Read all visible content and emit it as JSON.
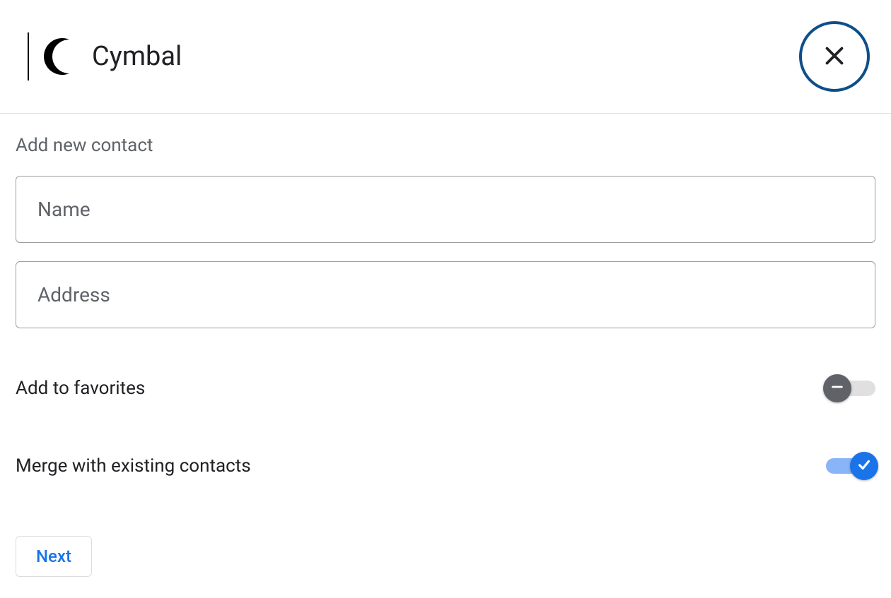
{
  "header": {
    "brand_name": "Cymbal"
  },
  "form": {
    "section_title": "Add new contact",
    "name_placeholder": "Name",
    "name_value": "",
    "address_placeholder": "Address",
    "address_value": "",
    "favorites_label": "Add to favorites",
    "favorites_on": false,
    "merge_label": "Merge with existing contacts",
    "merge_on": true,
    "next_label": "Next"
  },
  "colors": {
    "brand_close_border": "#0d4f8b",
    "primary_blue": "#1a73e8",
    "text_secondary": "#5f6368"
  }
}
